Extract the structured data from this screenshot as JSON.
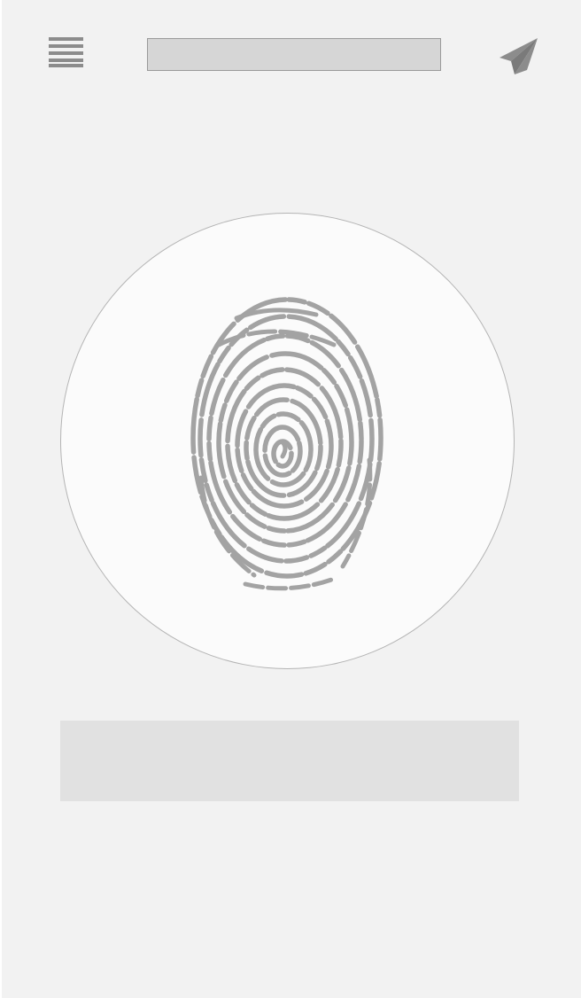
{
  "header": {
    "menu_icon": "hamburger-menu-icon",
    "title_text": "",
    "send_icon": "paper-plane-send-icon"
  },
  "scanner": {
    "icon": "fingerprint-icon"
  },
  "status": {
    "text": ""
  },
  "colors": {
    "background": "#f2f2f2",
    "icon_gray": "#8c8c8c",
    "fingerprint_gray": "#a3a3a3",
    "title_field": "#d6d6d6",
    "circle_fill": "#fbfbfb",
    "status_panel": "#e1e1e1"
  }
}
